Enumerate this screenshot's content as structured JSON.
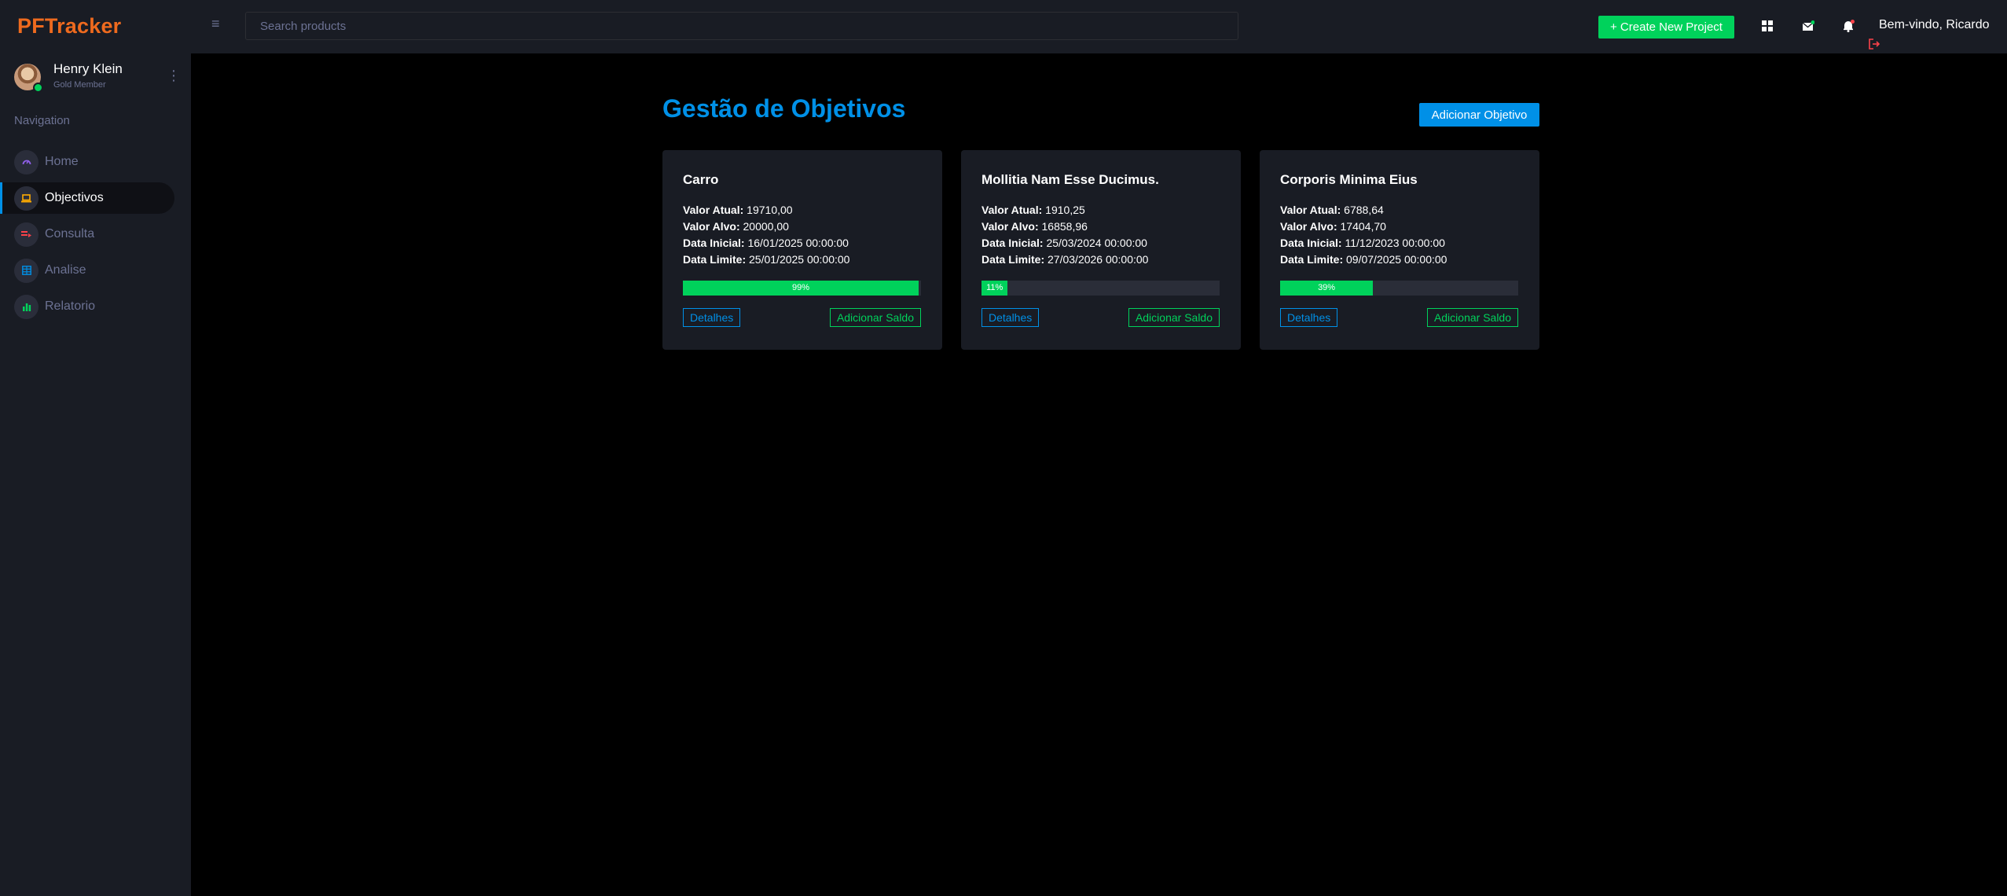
{
  "brand": "PFTracker",
  "profile": {
    "name": "Henry Klein",
    "tier": "Gold Member"
  },
  "sidebar": {
    "heading": "Navigation",
    "items": [
      {
        "label": "Home",
        "icon": "speedometer-icon",
        "color": "#8f5fe8",
        "active": false
      },
      {
        "label": "Objectivos",
        "icon": "laptop-icon",
        "color": "#ffab00",
        "active": true
      },
      {
        "label": "Consulta",
        "icon": "playlist-icon",
        "color": "#fc424a",
        "active": false
      },
      {
        "label": "Analise",
        "icon": "table-icon",
        "color": "#0090e7",
        "active": false
      },
      {
        "label": "Relatorio",
        "icon": "chart-bar-icon",
        "color": "#00d25b",
        "active": false
      }
    ]
  },
  "topbar": {
    "menu_icon": "≡",
    "search_placeholder": "Search products",
    "create_label": "+ Create New Project",
    "welcome": "Bem-vindo, Ricardo"
  },
  "main": {
    "title": "Gestão de Objetivos",
    "add_button": "Adicionar Objetivo",
    "labels": {
      "current": "Valor Atual:",
      "target": "Valor Alvo:",
      "start": "Data Inicial:",
      "deadline": "Data Limite:",
      "details": "Detalhes",
      "add_balance": "Adicionar Saldo"
    },
    "goals": [
      {
        "name": "Carro",
        "current": "19710,00",
        "target": "20000,00",
        "start": "16/01/2025 00:00:00",
        "deadline": "25/01/2025 00:00:00",
        "progress_label": "99%",
        "progress": 99
      },
      {
        "name": "Mollitia Nam Esse Ducimus.",
        "current": "1910,25",
        "target": "16858,96",
        "start": "25/03/2024 00:00:00",
        "deadline": "27/03/2026 00:00:00",
        "progress_label": "11%",
        "progress": 11
      },
      {
        "name": "Corporis Minima Eius",
        "current": "6788,64",
        "target": "17404,70",
        "start": "11/12/2023 00:00:00",
        "deadline": "09/07/2025 00:00:00",
        "progress_label": "39%",
        "progress": 39
      }
    ]
  },
  "colors": {
    "accent": "#0090e7",
    "success": "#00d25b",
    "brand": "#ee6a1e",
    "danger": "#fc424a"
  }
}
